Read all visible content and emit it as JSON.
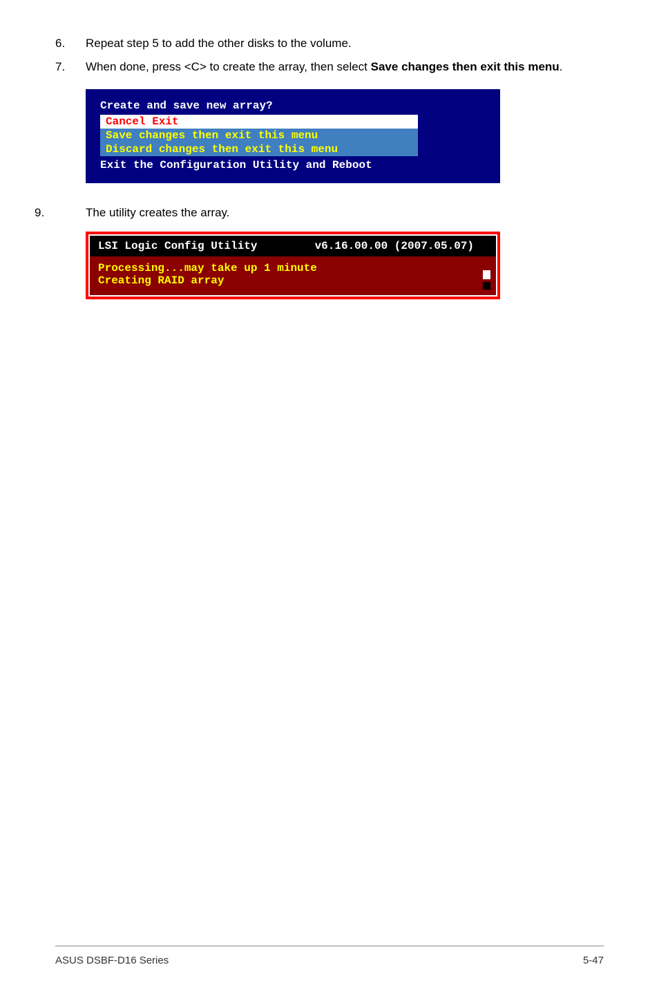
{
  "steps": {
    "step6": {
      "number": "6.",
      "text": "Repeat step 5 to add the other disks to the volume."
    },
    "step7": {
      "number": "7.",
      "prefix": "When done, press <C> to create the array, then select ",
      "bold": "Save changes then exit this menu",
      "suffix": "."
    },
    "step9": {
      "number": "9.",
      "text": "The utility creates the array."
    }
  },
  "bios1": {
    "title": "Create and save new array?",
    "menu_selected": "Cancel Exit",
    "menu_item1": "Save changes then exit this menu",
    "menu_item2": "Discard changes then exit this menu",
    "exit_line": "Exit the Configuration Utility and Reboot"
  },
  "bios2": {
    "header_left": "LSI Logic Config Utility",
    "header_right": "v6.16.00.00 (2007.05.07)",
    "body_line1": "Processing...may take up 1 minute",
    "body_line2": "Creating RAID array"
  },
  "footer": {
    "left": "ASUS DSBF-D16 Series",
    "right": "5-47"
  }
}
